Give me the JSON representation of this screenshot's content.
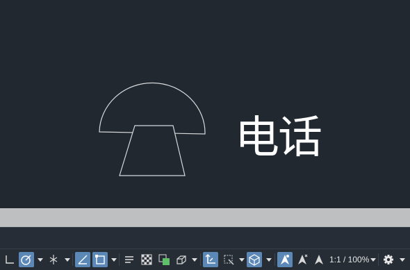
{
  "drawing": {
    "text": "电话",
    "line_color": "#d7d9db",
    "background": "#212830"
  },
  "status_bar": {
    "scale_label": "1:1 / 100%",
    "active_color": "#5b88b6",
    "icons": [
      "ucs-icon",
      "polar-tracking-icon",
      "isodraft-icon",
      "object-snap-icon",
      "object-snap-tracking-icon",
      "lineweight-icon",
      "transparency-icon",
      "selection-cycling-icon",
      "3d-object-snap-icon",
      "dynamic-ucs-icon",
      "selection-filter-icon",
      "gizmo-icon",
      "annotation-visibility-icon",
      "auto-scale-icon",
      "annotation-scale-icon",
      "workspace-gear-icon"
    ]
  }
}
